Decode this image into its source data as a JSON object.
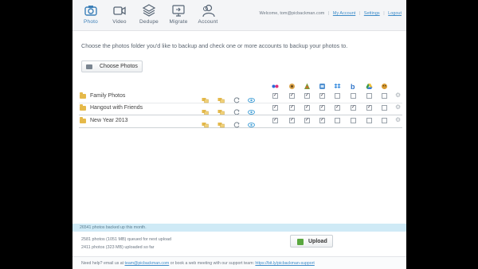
{
  "nav": {
    "items": [
      {
        "label": "Photo",
        "icon": "camera-icon",
        "active": true
      },
      {
        "label": "Video",
        "icon": "video-camera-icon",
        "active": false
      },
      {
        "label": "Dedupe",
        "icon": "layers-icon",
        "active": false
      },
      {
        "label": "Migrate",
        "icon": "migrate-icon",
        "active": false
      },
      {
        "label": "Account",
        "icon": "user-icon",
        "active": false
      }
    ]
  },
  "account_bar": {
    "welcome": "Welcome,",
    "email": "tom@picbackman.com",
    "my_account": "My Account",
    "settings": "Settings",
    "logout": "Logout"
  },
  "intro": "Choose the photos folder you'd like to backup and check one or more accounts to backup your photos to.",
  "choose_button": "Choose Photos",
  "services": [
    {
      "icon": "flickr-icon",
      "color": "#2b6bd8"
    },
    {
      "icon": "photobucket-icon",
      "color": "#d8a24a"
    },
    {
      "icon": "picasa-icon",
      "color": "#7c9a3a"
    },
    {
      "icon": "smugmug-icon",
      "color": "#4f8fd0"
    },
    {
      "icon": "dropbox-icon",
      "color": "#3b8fe0"
    },
    {
      "icon": "box-icon",
      "color": "#2f74c9"
    },
    {
      "icon": "google-drive-icon",
      "color": "#3a9a4a"
    },
    {
      "icon": "zenfolio-icon",
      "color": "#d89a30"
    }
  ],
  "folders": [
    {
      "name": "Family Photos",
      "checks": [
        true,
        true,
        true,
        true,
        false,
        false,
        false,
        false
      ]
    },
    {
      "name": "Hangout with Friends",
      "checks": [
        true,
        true,
        true,
        true,
        true,
        true,
        true,
        false
      ]
    },
    {
      "name": "New Year 2013",
      "checks": [
        true,
        true,
        true,
        true,
        false,
        false,
        false,
        false
      ]
    }
  ],
  "status": {
    "band": "26541 photos backed up this month.",
    "queued": "2581 photos (1051 MB) queued for next upload",
    "uploaded": "2411 photos (323 MB) uploaded so far",
    "upload_button": "Upload"
  },
  "footer": {
    "prefix": "Need help? email us at",
    "email": "team@picbackman.com",
    "middle": "or book a web meeting with our support team:",
    "link": "https://bit.ly/picbackman-support"
  }
}
